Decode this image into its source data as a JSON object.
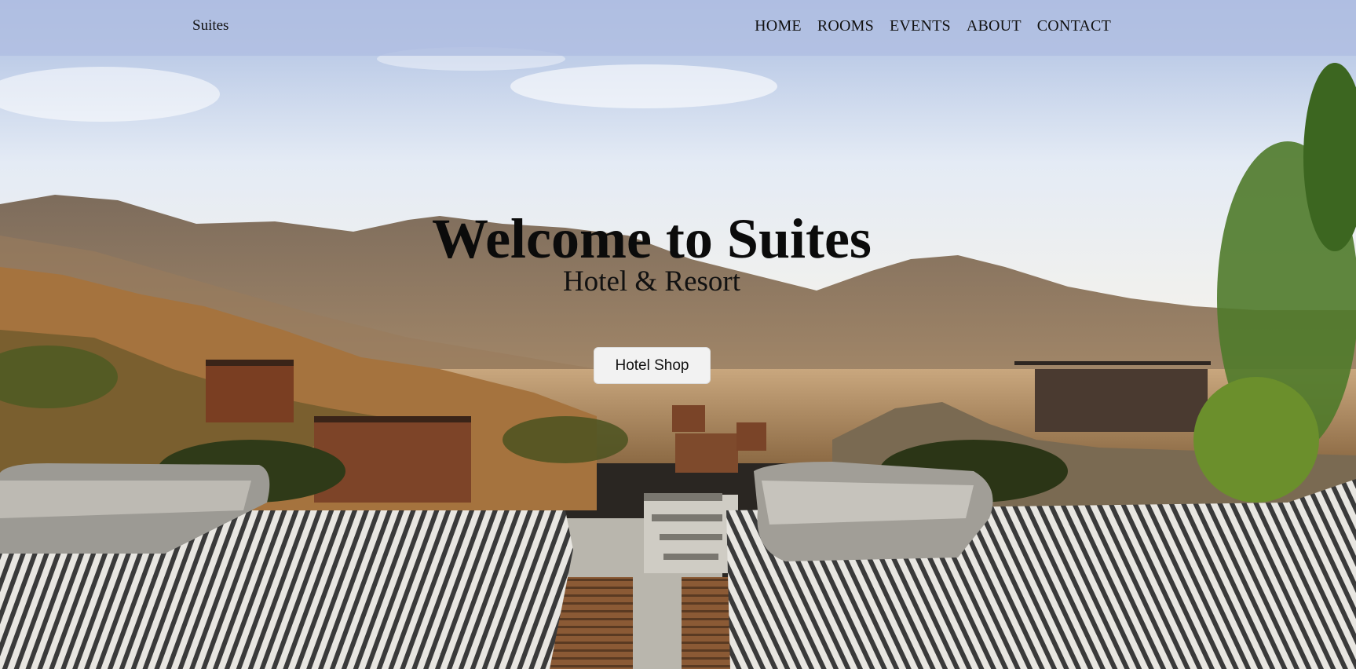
{
  "navbar": {
    "brand": "Suites",
    "links": [
      {
        "label": "HOME"
      },
      {
        "label": "ROOMS"
      },
      {
        "label": "EVENTS"
      },
      {
        "label": "ABOUT"
      },
      {
        "label": "CONTACT"
      }
    ]
  },
  "hero": {
    "title": "Welcome to Suites",
    "subtitle": "Hotel & Resort",
    "cta_label": "Hotel Shop"
  },
  "colors": {
    "navbar_bg": "#b0bee2",
    "sky_top": "#a9bce0",
    "sky_bottom": "#f4f2ee",
    "button_bg": "#f2f2f2",
    "text": "#111111"
  }
}
